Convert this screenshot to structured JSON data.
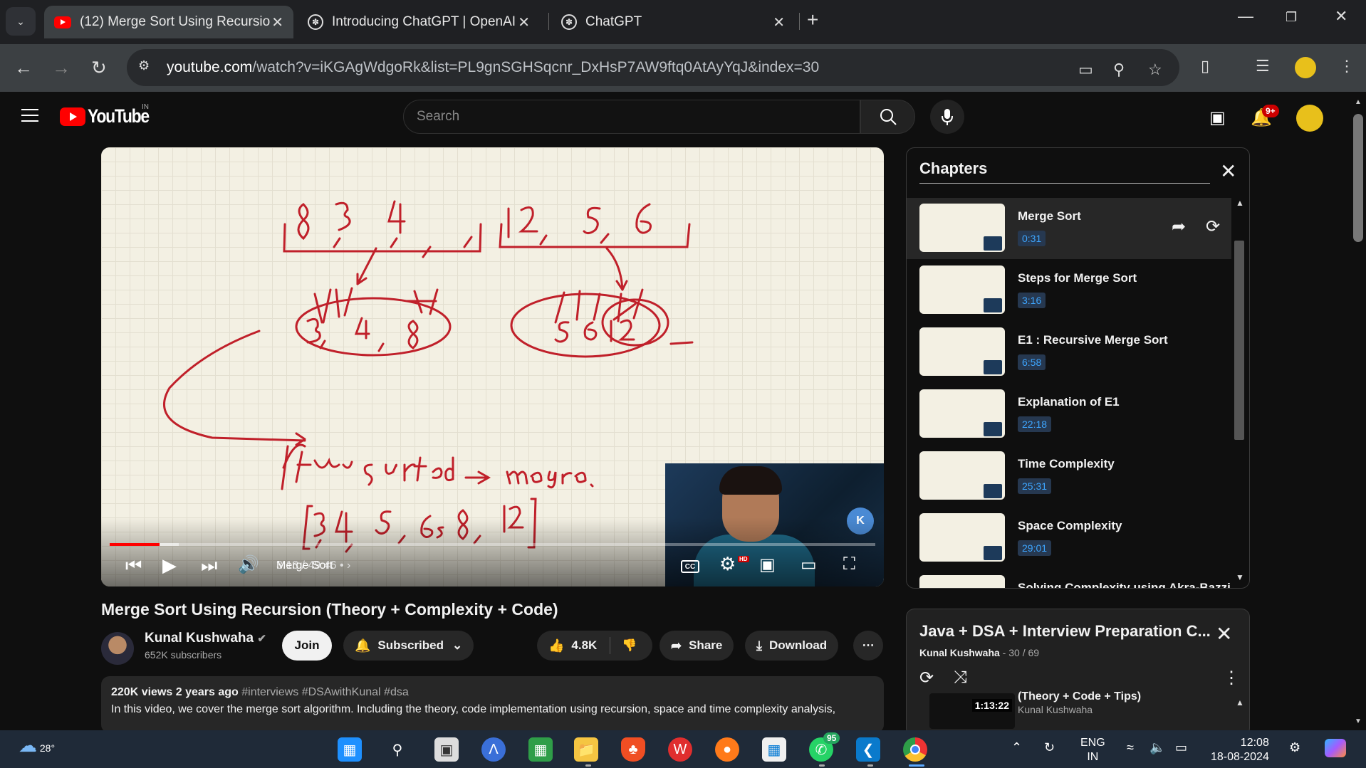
{
  "browser": {
    "tabs": [
      {
        "title": "(12) Merge Sort Using Recursio",
        "active": true,
        "favicon": "youtube-icon"
      },
      {
        "title": "Introducing ChatGPT | OpenAI",
        "active": false,
        "favicon": "openai-icon"
      },
      {
        "title": "ChatGPT",
        "active": false,
        "favicon": "openai-icon"
      }
    ],
    "url_domain": "youtube.com",
    "url_path": "/watch?v=iKGAgWdgoRk&list=PL9gnSGHSqcnr_DxHsP7AW9ftq0AtAyYqJ&index=30"
  },
  "youtube": {
    "country": "IN",
    "search_placeholder": "Search",
    "notif_badge": "9+"
  },
  "player": {
    "time": "3:13 / 49:46",
    "chapter": "Merge Sort",
    "progress": 0.065,
    "buffered": 0.09,
    "logo_badge": "K",
    "cc": "CC",
    "hd": "HD"
  },
  "video": {
    "title": "Merge Sort Using Recursion (Theory + Complexity + Code)",
    "channel": "Kunal Kushwaha",
    "subscribers": "652K subscribers",
    "join_label": "Join",
    "subscribed_label": "Subscribed",
    "likes": "4.8K",
    "share_label": "Share",
    "download_label": "Download",
    "views_date": "220K views  2 years ago",
    "tags": "#interviews #DSAwithKunal #dsa",
    "description": "In this video, we cover the merge sort algorithm. Including the theory, code implementation using recursion, space and time complexity analysis,"
  },
  "chapters": {
    "title": "Chapters",
    "items": [
      {
        "title": "Merge Sort",
        "time": "0:31"
      },
      {
        "title": "Steps for Merge Sort",
        "time": "3:16"
      },
      {
        "title": "E1 : Recursive Merge Sort",
        "time": "6:58"
      },
      {
        "title": "Explanation of E1",
        "time": "22:18"
      },
      {
        "title": "Time Complexity",
        "time": "25:31"
      },
      {
        "title": "Space Complexity",
        "time": "29:01"
      },
      {
        "title": "Solving Complexity using Akra-Bazzi",
        "time": ""
      }
    ]
  },
  "playlist": {
    "title": "Java + DSA + Interview Preparation C...",
    "author": "Kunal Kushwaha",
    "position": "30 / 69",
    "next_duration": "1:13:22",
    "next_fragment": "(Theory + Code + Tips)",
    "next_author": "Kunal Kushwaha"
  },
  "taskbar": {
    "temperature": "28°",
    "lang_line1": "ENG",
    "lang_line2": "IN",
    "time": "12:08",
    "date": "18-08-2024",
    "whatsapp_badge": "95"
  }
}
